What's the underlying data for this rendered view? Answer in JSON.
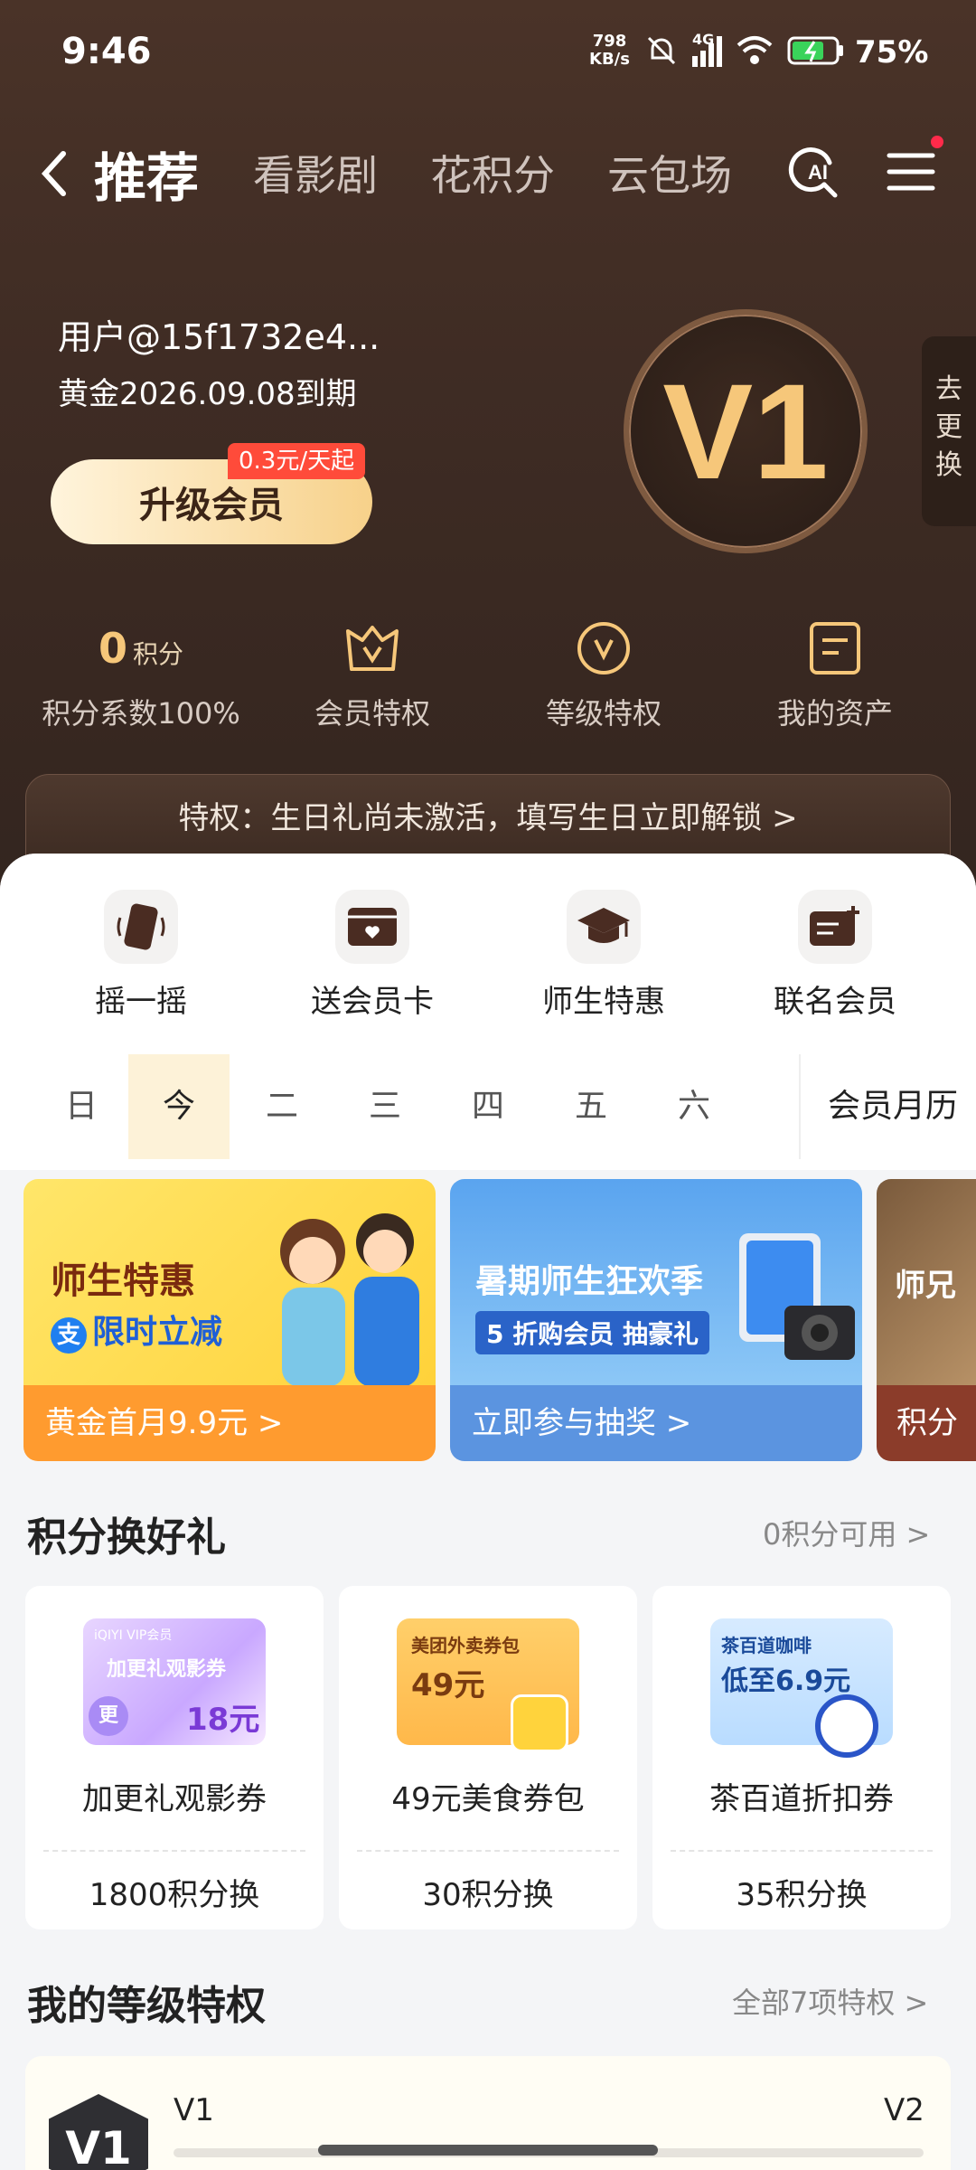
{
  "status": {
    "time": "9:46",
    "net_speed_top": "798",
    "net_speed_unit": "KB/s",
    "net_type": "4G",
    "battery": "75%"
  },
  "nav": {
    "tabs": [
      "推荐",
      "看影剧",
      "花积分",
      "云包场"
    ],
    "ai_label": "AI"
  },
  "user": {
    "name": "用户@15f1732e4...",
    "expire": "黄金2026.09.08到期",
    "upgrade_label": "升级会员",
    "promo": "0.3元/天起",
    "level_badge": "V1",
    "side_tab": "去更换"
  },
  "stats": [
    {
      "num": "0",
      "unit": "积分",
      "label": "积分系数100%"
    },
    {
      "label": "会员特权",
      "icon": "crown-v-icon"
    },
    {
      "label": "等级特权",
      "icon": "v-circle-icon"
    },
    {
      "label": "我的资产",
      "icon": "document-icon"
    }
  ],
  "privilege_bar": "特权：生日礼尚未激活，填写生日立即解锁 >",
  "quick_actions": [
    {
      "label": "摇一摇",
      "icon": "phone-shake-icon"
    },
    {
      "label": "送会员卡",
      "icon": "gift-card-icon"
    },
    {
      "label": "师生特惠",
      "icon": "graduation-cap-icon"
    },
    {
      "label": "联名会员",
      "icon": "card-plus-icon"
    }
  ],
  "calendar": {
    "days": [
      "日",
      "今",
      "二",
      "三",
      "四",
      "五",
      "六"
    ],
    "selected": "今",
    "link": "会员月历"
  },
  "banners": [
    {
      "title": "师生特惠",
      "subtitle": "限时立减",
      "footer": "黄金首月9.9元 >"
    },
    {
      "title": "暑期师生狂欢季",
      "subtitle": "5 折购会员  抽豪礼",
      "footer": "立即参与抽奖 >"
    },
    {
      "title": "师兄",
      "footer": "积分兑"
    }
  ],
  "points_section": {
    "title": "积分换好礼",
    "available": "0积分可用 >"
  },
  "gifts": [
    {
      "name": "加更礼观影券",
      "cost": "1800积分换",
      "thumb_brand": "iQIYI VIP会员",
      "thumb_title": "加更礼观影券",
      "thumb_value": "18元",
      "thumb_badge": "更"
    },
    {
      "name": "49元美食券包",
      "cost": "30积分换",
      "thumb_title": "美团外卖券包",
      "thumb_value": "49元"
    },
    {
      "name": "茶百道折扣券",
      "cost": "35积分换",
      "thumb_title": "茶百道咖啡",
      "thumb_value": "低至6.9元"
    }
  ],
  "level_section": {
    "title": "我的等级特权",
    "link": "全部7项特权 >",
    "current": "V1",
    "next": "V2",
    "badge": "V1"
  }
}
